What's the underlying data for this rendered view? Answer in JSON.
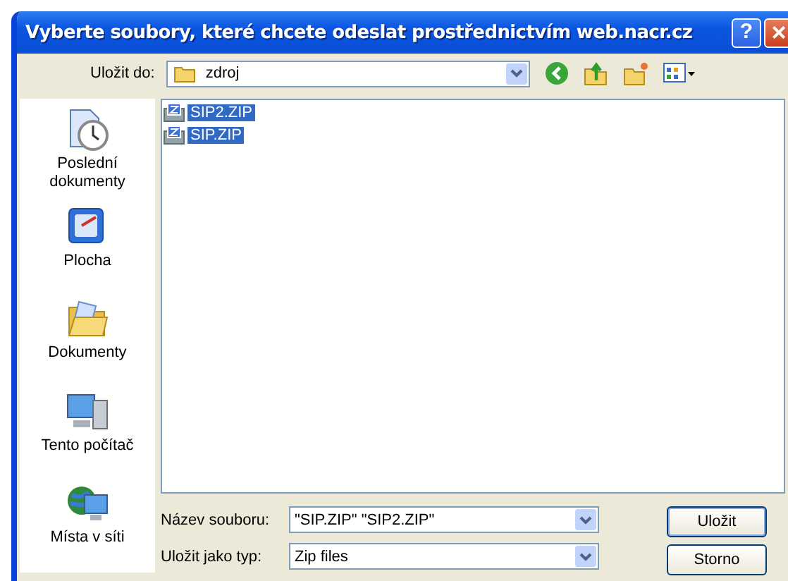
{
  "window": {
    "title": "Vyberte soubory, které chcete odeslat prostřednictvím web.nacr.cz"
  },
  "title_buttons": [
    {
      "kind": "help",
      "label": "?"
    },
    {
      "kind": "close",
      "label": "×"
    }
  ],
  "save_in": {
    "label": "Uložit do:",
    "value": "zdroj"
  },
  "places": [
    {
      "kind": "recent",
      "label": "Poslední dokumenty"
    },
    {
      "kind": "desktop",
      "label": "Plocha"
    },
    {
      "kind": "documents",
      "label": "Dokumenty"
    },
    {
      "kind": "computer",
      "label": "Tento počítač"
    },
    {
      "kind": "network",
      "label": "Místa v síti"
    }
  ],
  "files": [
    {
      "name": "SIP2.ZIP",
      "selected": true
    },
    {
      "name": "SIP.ZIP",
      "selected": true
    }
  ],
  "filename": {
    "label": "Název souboru:",
    "value": "\"SIP.ZIP\" \"SIP2.ZIP\""
  },
  "filetype": {
    "label": "Uložit jako typ:",
    "value": "Zip files"
  },
  "buttons": [
    {
      "label": "Uložit",
      "default": true
    },
    {
      "label": "Storno",
      "default": false
    }
  ]
}
